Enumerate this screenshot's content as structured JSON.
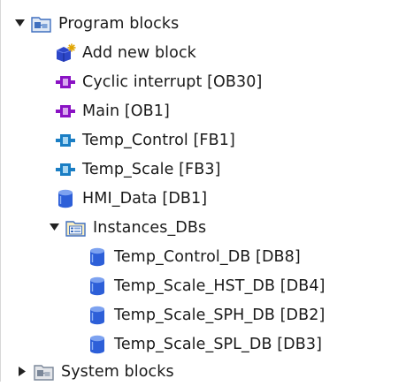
{
  "tree": {
    "program_blocks": {
      "label": "Program blocks",
      "icon": "folder-icon",
      "expanded": true,
      "children": [
        {
          "label": "Add new block",
          "icon": "add-new-block-icon"
        },
        {
          "label": "Cyclic interrupt [OB30]",
          "icon": "ob-block-icon"
        },
        {
          "label": "Main [OB1]",
          "icon": "ob-block-icon"
        },
        {
          "label": "Temp_Control [FB1]",
          "icon": "fb-block-icon"
        },
        {
          "label": "Temp_Scale [FB3]",
          "icon": "fb-block-icon"
        },
        {
          "label": "HMI_Data [DB1]",
          "icon": "db-icon"
        }
      ]
    },
    "instances_dbs": {
      "label": "Instances_DBs",
      "icon": "instances-folder-icon",
      "expanded": true,
      "children": [
        {
          "label": "Temp_Control_DB [DB8]",
          "icon": "db-icon"
        },
        {
          "label": "Temp_Scale_HST_DB [DB4]",
          "icon": "db-icon"
        },
        {
          "label": "Temp_Scale_SPH_DB [DB2]",
          "icon": "db-icon"
        },
        {
          "label": "Temp_Scale_SPL_DB [DB3]",
          "icon": "db-icon"
        }
      ]
    },
    "system_blocks": {
      "label": "System blocks",
      "icon": "folder-icon",
      "expanded": false
    }
  },
  "colors": {
    "folder_blue": "#3f6fbf",
    "ob_purple": "#8a12c4",
    "fb_blue": "#1a7ec4",
    "db_blue": "#2d5fd8",
    "toggle": "#222222"
  }
}
